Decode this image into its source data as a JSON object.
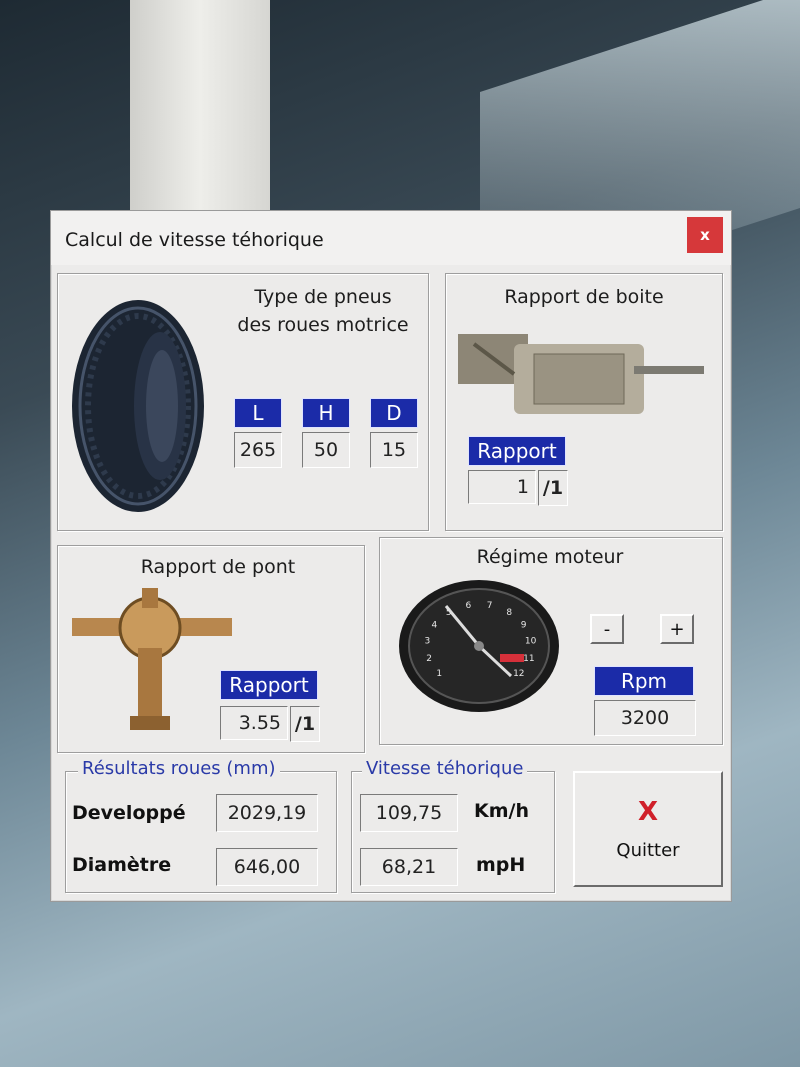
{
  "window": {
    "title": "Calcul de vitesse téhorique",
    "close_label": "x"
  },
  "tyre": {
    "title_line1": "Type de pneus",
    "title_line2": "des roues motrice",
    "headers": [
      "L",
      "H",
      "D"
    ],
    "values": [
      "265",
      "50",
      "15"
    ]
  },
  "gearbox": {
    "title": "Rapport de boite",
    "header": "Rapport",
    "value": "1",
    "suffix": "/1"
  },
  "axle": {
    "title": "Rapport de pont",
    "header": "Rapport",
    "value": "3.55",
    "suffix": "/1"
  },
  "engine": {
    "title": "Régime moteur",
    "minus_label": "-",
    "plus_label": "+",
    "header": "Rpm",
    "value": "3200",
    "tach_numbers": [
      "1",
      "2",
      "3",
      "4",
      "5",
      "6",
      "7",
      "8",
      "9",
      "10",
      "11",
      "12"
    ]
  },
  "wheel_results": {
    "legend": "Résultats roues (mm)",
    "dev_label": "Developpé",
    "dev_value": "2029,19",
    "diam_label": "Diamètre",
    "diam_value": "646,00"
  },
  "speed": {
    "legend": "Vitesse téhorique",
    "kmh_value": "109,75",
    "kmh_unit": "Km/h",
    "mph_value": "68,21",
    "mph_unit": "mpH"
  },
  "quit": {
    "icon": "X",
    "label": "Quitter"
  },
  "colors": {
    "header_blue": "#1b2ba8",
    "close_red": "#d6383a",
    "legend_blue": "#2a3aa8"
  }
}
